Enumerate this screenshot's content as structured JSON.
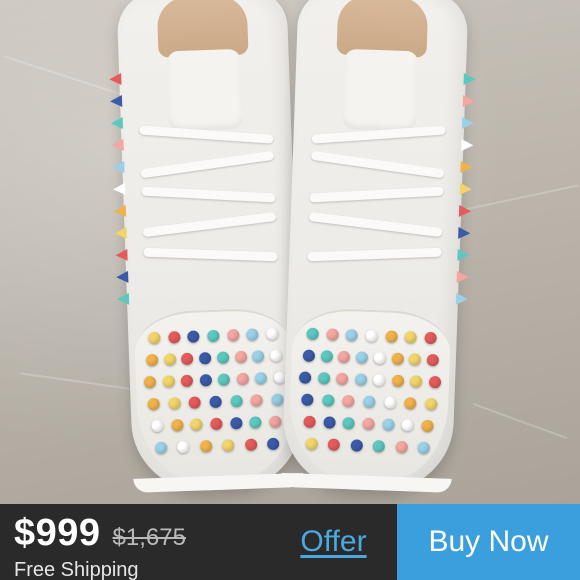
{
  "listing": {
    "price": "$999",
    "original_price": "$1,675",
    "shipping": "Free Shipping"
  },
  "actions": {
    "offer_label": "Offer",
    "buy_label": "Buy Now"
  },
  "colors": {
    "accent": "#3a9fdc",
    "offer_text": "#4aa9e0",
    "bar_background": "#2a2a2a"
  },
  "product_image": {
    "studs_palette": [
      "#f2d46a",
      "#e45b5b",
      "#3b5ba8",
      "#5cc8c0",
      "#f4a6a0",
      "#9ad1e8",
      "#ffffff",
      "#f0b24a"
    ]
  }
}
